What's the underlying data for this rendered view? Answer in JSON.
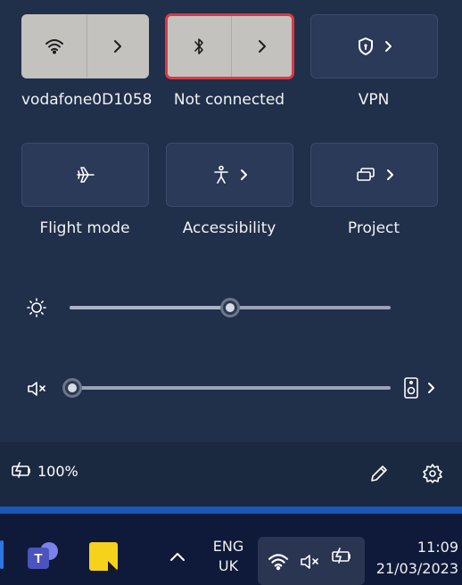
{
  "quick_settings": {
    "tiles": [
      {
        "label": "vodafone0D1058",
        "icon": "wifi-icon",
        "active": true,
        "has_chevron": true
      },
      {
        "label": "Not connected",
        "icon": "bluetooth-icon",
        "active": true,
        "has_chevron": true,
        "highlighted": true
      },
      {
        "label": "VPN",
        "icon": "vpn-shield-icon",
        "active": false,
        "has_chevron": true
      },
      {
        "label": "Flight mode",
        "icon": "airplane-icon",
        "active": false,
        "has_chevron": false
      },
      {
        "label": "Accessibility",
        "icon": "accessibility-icon",
        "active": false,
        "has_chevron": true
      },
      {
        "label": "Project",
        "icon": "project-icon",
        "active": false,
        "has_chevron": true
      }
    ],
    "brightness": {
      "icon": "brightness-icon",
      "level": 0.5
    },
    "volume": {
      "icon": "speaker-muted-icon",
      "level": 0.0,
      "output_icon": "speaker-device-icon"
    }
  },
  "footer": {
    "battery": {
      "icon": "battery-charging-icon",
      "text": "100%"
    },
    "edit_icon": "pencil-icon",
    "settings_icon": "gear-icon"
  },
  "taskbar": {
    "apps": [
      "teams-icon",
      "sticky-notes-icon"
    ],
    "overflow_icon": "chevron-up-icon",
    "language": {
      "line1": "ENG",
      "line2": "UK"
    },
    "tray": [
      "wifi-icon",
      "speaker-muted-icon",
      "battery-charging-icon"
    ],
    "clock": {
      "time": "11:09",
      "date": "21/03/2023"
    }
  },
  "colors": {
    "panel_bg": "#202f4a",
    "tile_bg": "#2a3a58",
    "active_tile_bg": "#c4c2bf",
    "highlight": "#d83a45",
    "taskbar_accent": "#1b57b7"
  }
}
